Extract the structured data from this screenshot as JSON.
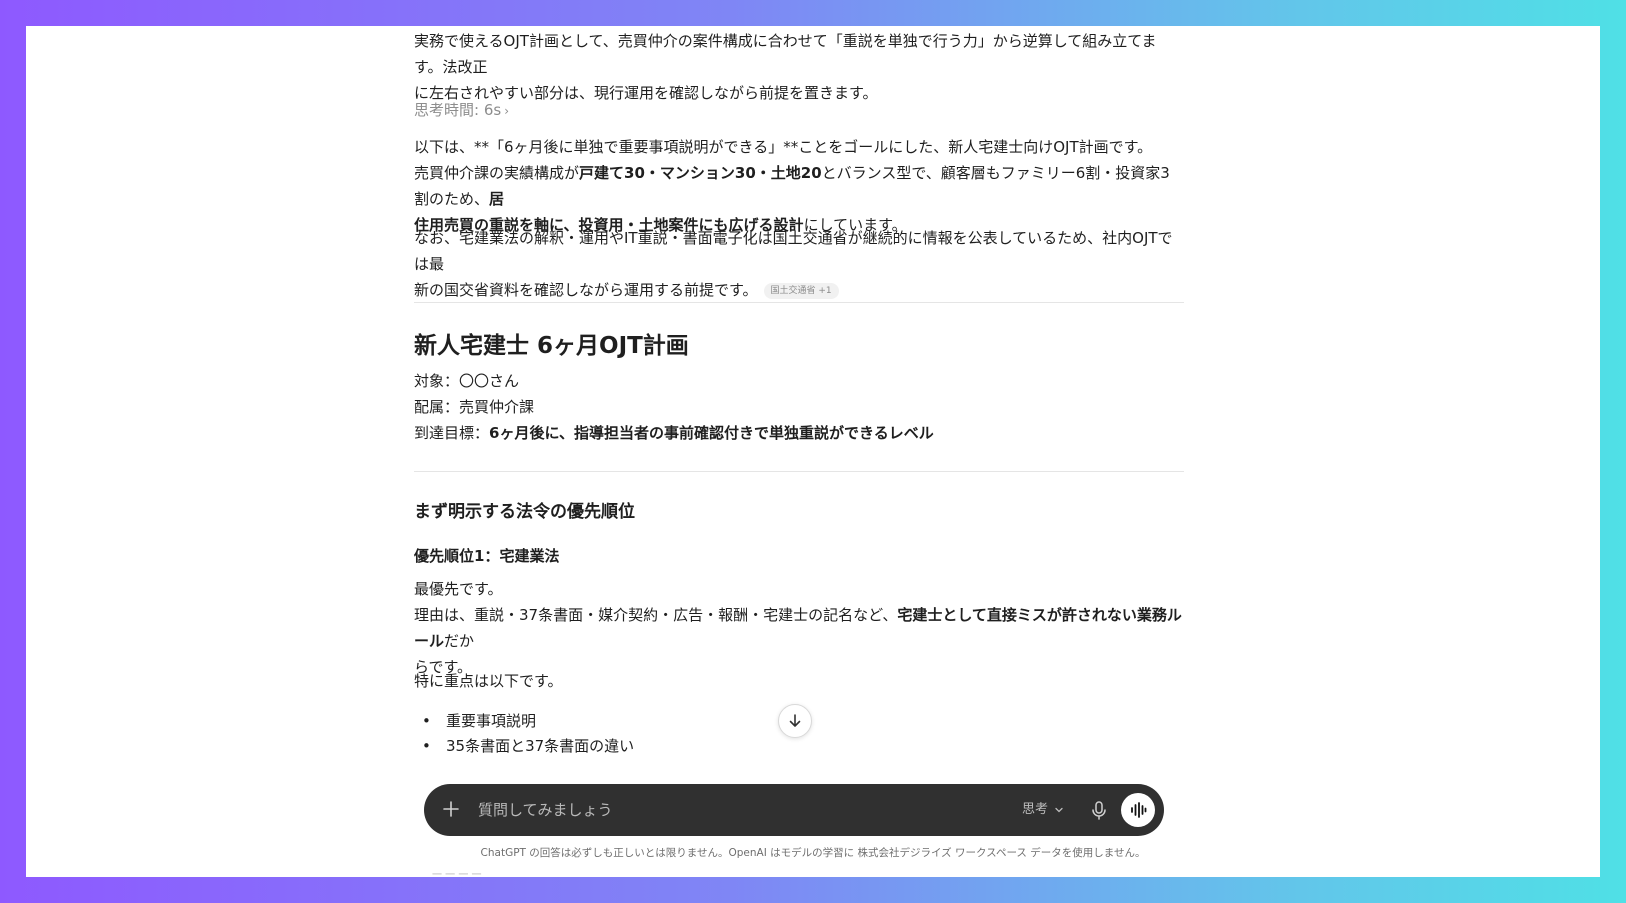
{
  "intro": {
    "line1": "実務で使えるOJT計画として、売買仲介の案件構成に合わせて「重説を単独で行う力」から逆算して組み立てます。法改正",
    "line2": "に左右されやすい部分は、現行運用を確認しながら前提を置きます。"
  },
  "thinking": {
    "label": "思考時間: 6s",
    "chevron": "›"
  },
  "para1": {
    "line1": "以下は、**「6ヶ月後に単独で重要事項説明ができる」**ことをゴールにした、新人宅建士向けOJT計画です。",
    "line2_a": "売買仲介課の実績構成が",
    "line2_b": "戸建て30・マンション30・土地20",
    "line2_c": "とバランス型で、顧客層もファミリー6割・投資家3割のため、",
    "line2_d": "居",
    "line3_a": "住用売買の重説を軸に、投資用・土地案件にも広げる設計",
    "line3_b": "にしています。"
  },
  "para2": {
    "line1": "なお、宅建業法の解釈・運用やIT重説・書面電子化は国土交通省が継続的に情報を公表しているため、社内OJTでは最",
    "line2": "新の国交省資料を確認しながら運用する前提です。",
    "source_chip": "国土交通省 +1"
  },
  "plan": {
    "title": "新人宅建士 6ヶ月OJT計画",
    "target": "対象：〇〇さん",
    "dept": "配属：売買仲介課",
    "goal_label": "到達目標：",
    "goal_value": "6ヶ月後に、指導担当者の事前確認付きで単独重説ができるレベル"
  },
  "priority": {
    "heading": "まず明示する法令の優先順位",
    "sub1": "優先順位1：宅建業法",
    "top": "最優先です。",
    "reason_a": "理由は、重説・37条書面・媒介契約・広告・報酬・宅建士の記名など、",
    "reason_b": "宅建士として直接ミスが許されない業務ルール",
    "reason_c": "だか",
    "reason_d": "らです。",
    "focus": "特に重点は以下です。",
    "bullets": [
      "重要事項説明",
      "35条書面と37条書面の違い"
    ]
  },
  "composer": {
    "placeholder": "質問してみましょう",
    "mode_label": "思考"
  },
  "footer": {
    "disclaimer": "ChatGPT の回答は必ずしも正しいとは限りません。OpenAI はモデルの学習に 株式会社デジライズ ワークスペース データを使用しません。",
    "cutoff": "一 一 一 一"
  }
}
